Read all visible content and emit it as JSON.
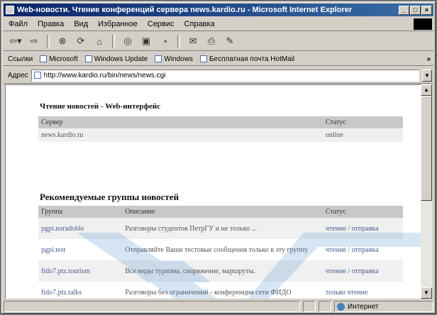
{
  "window": {
    "title": "Web-новости. Чтение конференций сервера news.kardio.ru - Microsoft Internet Explorer",
    "buttons": [
      "_",
      "□",
      "×"
    ]
  },
  "menu": [
    "Файл",
    "Правка",
    "Вид",
    "Избранное",
    "Сервис",
    "Справка"
  ],
  "toolbar": {
    "icons": [
      "back-icon",
      "forward-icon",
      "stop-icon",
      "refresh-icon",
      "home-icon",
      "search-icon",
      "favorites-icon",
      "history-icon",
      "mail-icon",
      "print-icon",
      "edit-icon"
    ]
  },
  "links": {
    "label": "Ссылки",
    "items": [
      "Microsoft",
      "Windows Update",
      "Windows",
      "Бесплатная почта HotMail"
    ]
  },
  "address": {
    "label": "Адрес",
    "url": "http://www.kardio.ru/bin/news/news.cgi"
  },
  "page": {
    "section1_title": "Чтение новостей - Web-интерфейс",
    "servers": {
      "headers": [
        "Сервер",
        "Статус"
      ],
      "rows": [
        [
          "news.kardio.ru",
          "online"
        ]
      ]
    },
    "section2_title": "Рекомендуемые группы новостей",
    "groups": {
      "headers": [
        "Группа",
        "Описание",
        "Статус"
      ],
      "rows": [
        [
          "pgpi.noradoble",
          "Разговоры студентов ПетрГУ и не только ...",
          "чтение / отправка"
        ],
        [
          "pgpi.test",
          "Отправляйте Ваши тестовые сообщения только в эту группу",
          "чтение / отправка"
        ],
        [
          "fido7.ptz.tourism",
          "Все виды туризма, снаряжение, маршруты.",
          "чтение / отправка"
        ],
        [
          "fido7.ptz.talks",
          "Разговоры без ограничений - конференция сети ФИДО",
          "только чтение"
        ]
      ]
    }
  },
  "status": {
    "text": "",
    "zone": "Интернет"
  }
}
